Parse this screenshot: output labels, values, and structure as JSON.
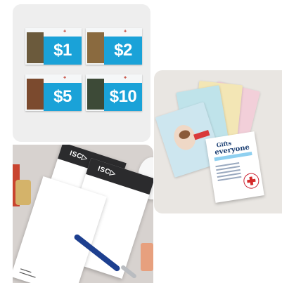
{
  "donation_cards": [
    {
      "amount": "$1",
      "photo_color": "#6b5a3c"
    },
    {
      "amount": "$2",
      "photo_color": "#8a6a3f"
    },
    {
      "amount": "$5",
      "photo_color": "#7b4a2e"
    },
    {
      "amount": "$10",
      "photo_color": "#3d4a37"
    }
  ],
  "gift_card": {
    "title_small": "Gifts",
    "title_large": "everyone",
    "colors": {
      "pastel_blue": "#bfe3ea",
      "pastel_yellow": "#f3e6b5",
      "pastel_pink": "#f2cfd9",
      "pastel_cream": "#f5ead3"
    }
  },
  "notepad": {
    "brand": "ISC▷",
    "pen_color": "#1d3f8f"
  }
}
